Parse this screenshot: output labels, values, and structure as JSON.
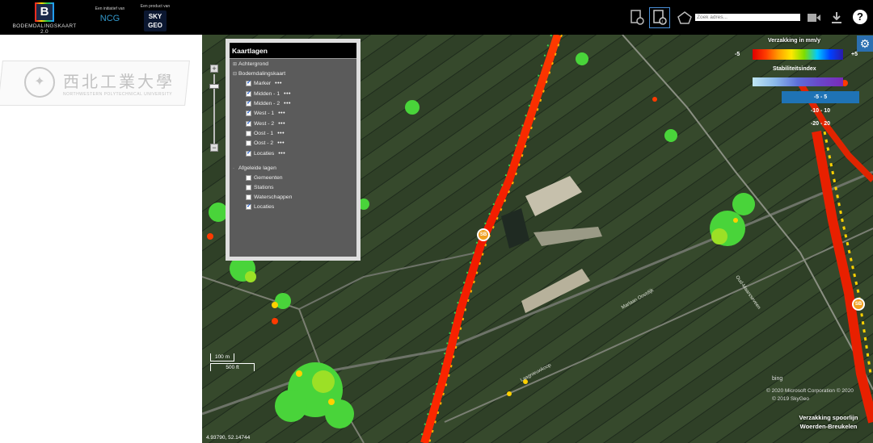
{
  "header": {
    "brand_letter": "B",
    "brand_name": "BODEMDALINGSKAART 2.0",
    "initiative_label": "Een initiatief van",
    "initiative_name": "NCG",
    "product_label": "Een product van",
    "product_name_line1": "SKY",
    "product_name_line2": "GEO",
    "search_placeholder": "Zoek adres...",
    "help_label": "?"
  },
  "watermark": {
    "cn": "西北工業大學",
    "en": "NORTHWESTERN POLYTECHNICAL UNIVERSITY"
  },
  "layers": {
    "title": "Kaartlagen",
    "groups": [
      {
        "label": "Achtergrond",
        "expand": "⊞"
      },
      {
        "label": "Bodemdalingskaart",
        "expand": "⊟"
      }
    ],
    "items": [
      {
        "label": "Marker",
        "checked": true,
        "dots": "•••"
      },
      {
        "label": "Midden - 1",
        "checked": true,
        "dots": "•••"
      },
      {
        "label": "Midden - 2",
        "checked": true,
        "dots": "•••"
      },
      {
        "label": "West - 1",
        "checked": true,
        "dots": "•••"
      },
      {
        "label": "West - 2",
        "checked": true,
        "dots": "•••"
      },
      {
        "label": "Oost - 1",
        "checked": false,
        "dots": "•••"
      },
      {
        "label": "Oost - 2",
        "checked": false,
        "dots": "•••"
      },
      {
        "label": "Locaties",
        "checked": true,
        "dots": "•••"
      }
    ],
    "derived_title": "Afgeleide lagen",
    "derived_items": [
      {
        "label": "Gemeenten",
        "checked": false
      },
      {
        "label": "Stations",
        "checked": false
      },
      {
        "label": "Waterschappen",
        "checked": false
      },
      {
        "label": "Locaties",
        "checked": true
      }
    ]
  },
  "legend": {
    "velocity_title": "Verzakking in mm/y",
    "velocity_min": "-5",
    "velocity_max": "+5",
    "stability_title": "Stabiliteitsindex",
    "ranges": [
      "-5 - 5",
      "-10 - 10",
      "-20 - 20"
    ],
    "selected_range": "-5 - 5"
  },
  "map": {
    "scale_m": "100 m",
    "scale_ft": "500 ft",
    "coordinates": "4.93790, 52.14744",
    "marker_label": "SB",
    "bing_label": "bing",
    "copyright_ms": "© 2020 Microsoft Corporation © 2020",
    "copyright_sky": "© 2019 SkyGeo",
    "caption_line1": "Verzakking spoorlijn",
    "caption_line2": "Woerden-Breukelen"
  },
  "colors": {
    "accent": "#2b6fb0",
    "selected_range": "#1f73b5",
    "panel_bg": "#5b5b5b"
  }
}
